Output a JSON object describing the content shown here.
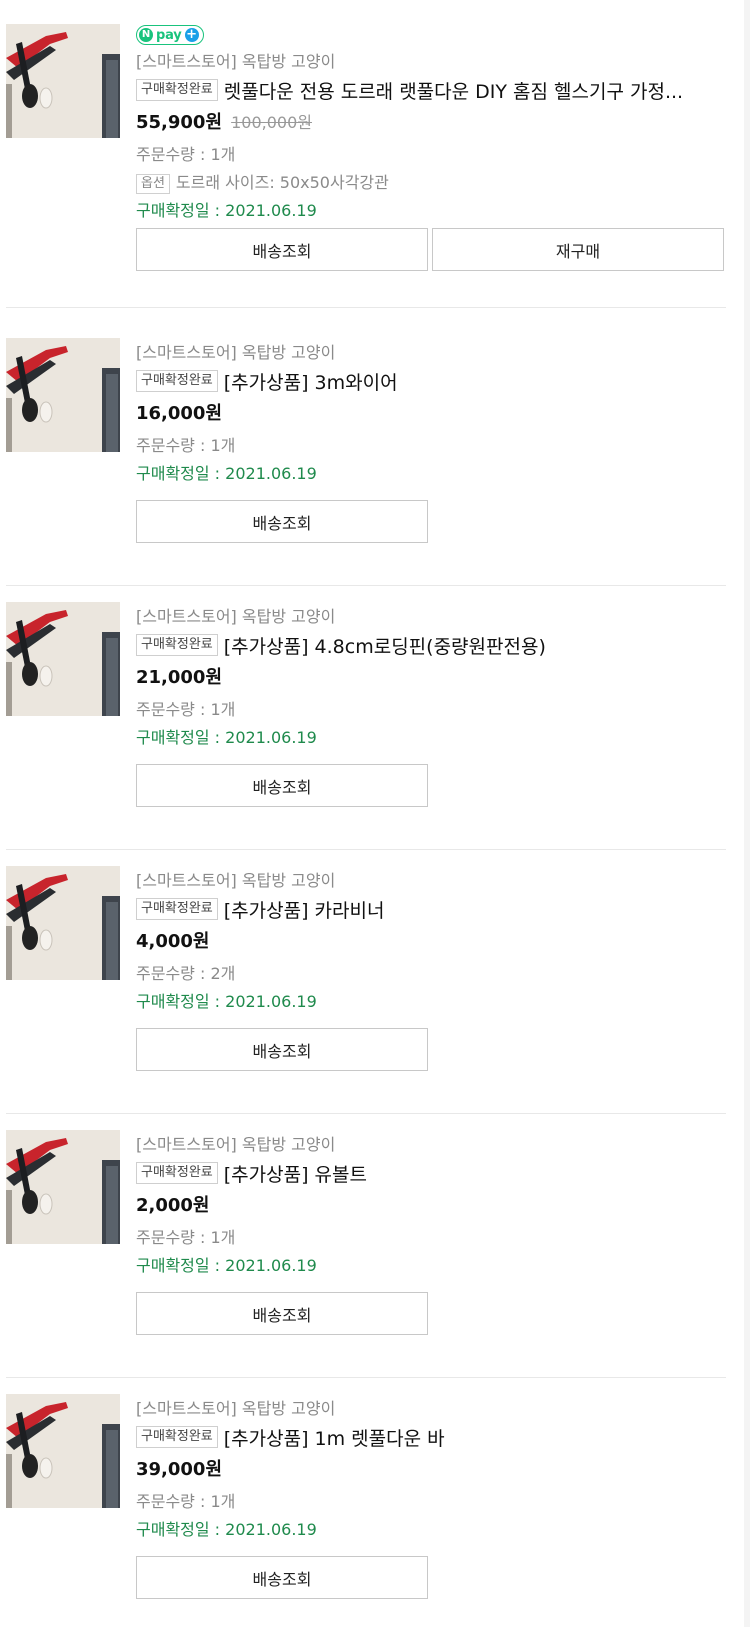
{
  "store_name": "[스마트스토어] 옥탑방 고양이",
  "status_badge": "구매확정완료",
  "npay_label": "pay",
  "qty_prefix": "주문수량 : ",
  "confirm_prefix": "구매확정일 : ",
  "buttons": {
    "tracking": "배송조회",
    "rebuy": "재구매"
  },
  "orders": [
    {
      "title": "렛풀다운 전용 도르래 랫풀다운 DIY 홈짐 헬스기구 가정...",
      "price": "55,900원",
      "original_price": "100,000원",
      "quantity": "1개",
      "option_tag": "옵션",
      "option_value": "도르래 사이즈: 50x50사각강관",
      "confirm_date": "2021.06.19"
    },
    {
      "title": "[추가상품] 3m와이어",
      "price": "16,000원",
      "quantity": "1개",
      "confirm_date": "2021.06.19"
    },
    {
      "title": "[추가상품] 4.8cm로딩핀(중량원판전용)",
      "price": "21,000원",
      "quantity": "1개",
      "confirm_date": "2021.06.19"
    },
    {
      "title": "[추가상품] 카라비너",
      "price": "4,000원",
      "quantity": "2개",
      "confirm_date": "2021.06.19"
    },
    {
      "title": "[추가상품] 유볼트",
      "price": "2,000원",
      "quantity": "1개",
      "confirm_date": "2021.06.19"
    },
    {
      "title": "[추가상품] 1m 렛풀다운 바",
      "price": "39,000원",
      "quantity": "1개",
      "confirm_date": "2021.06.19"
    }
  ]
}
